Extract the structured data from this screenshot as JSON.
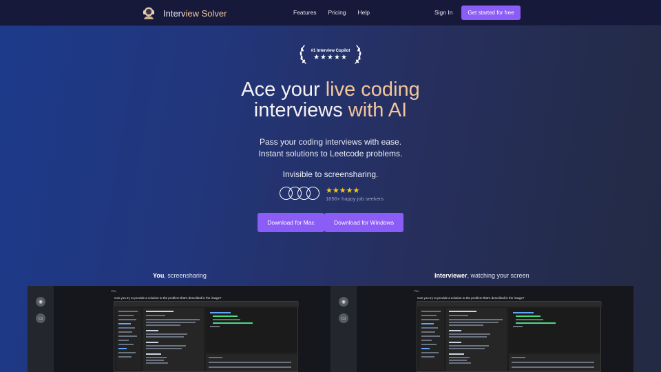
{
  "nav": {
    "brand_prefix": "Interv",
    "brand_accent": "iew Solver",
    "links": [
      "Features",
      "Pricing",
      "Help"
    ],
    "signin": "Sign In",
    "cta": "Get started for free"
  },
  "badge": {
    "title": "#1 Interview Copilot",
    "stars": "★★★★★"
  },
  "hero": {
    "line1_white": "Ace your ",
    "line1_accent": "live coding",
    "line2_white": "interviews ",
    "line2_accent": "with AI",
    "sub_line1": "Pass your coding interviews with ease.",
    "sub_line2": "Instant solutions to Leetcode problems.",
    "sub_line3": "Invisible to screensharing."
  },
  "social_proof": {
    "stars": "★★★★★",
    "text": "1656+ happy job seekers"
  },
  "downloads": {
    "mac": "Download for Mac",
    "windows": "Download for Windows"
  },
  "demo": {
    "left_caption_bold": "You",
    "left_caption_rest": ", screensharing",
    "right_caption_bold": "Interviewer",
    "right_caption_rest": ", watching your screen",
    "chat_sender": "You",
    "chat_message": "Can you try to provide a solution to the problem that's described in the image?"
  },
  "colors": {
    "accent_button": "#8b5cf6",
    "headline_accent": "#f3c69b",
    "star_yellow": "#facc15",
    "nav_bg": "#17193a"
  }
}
